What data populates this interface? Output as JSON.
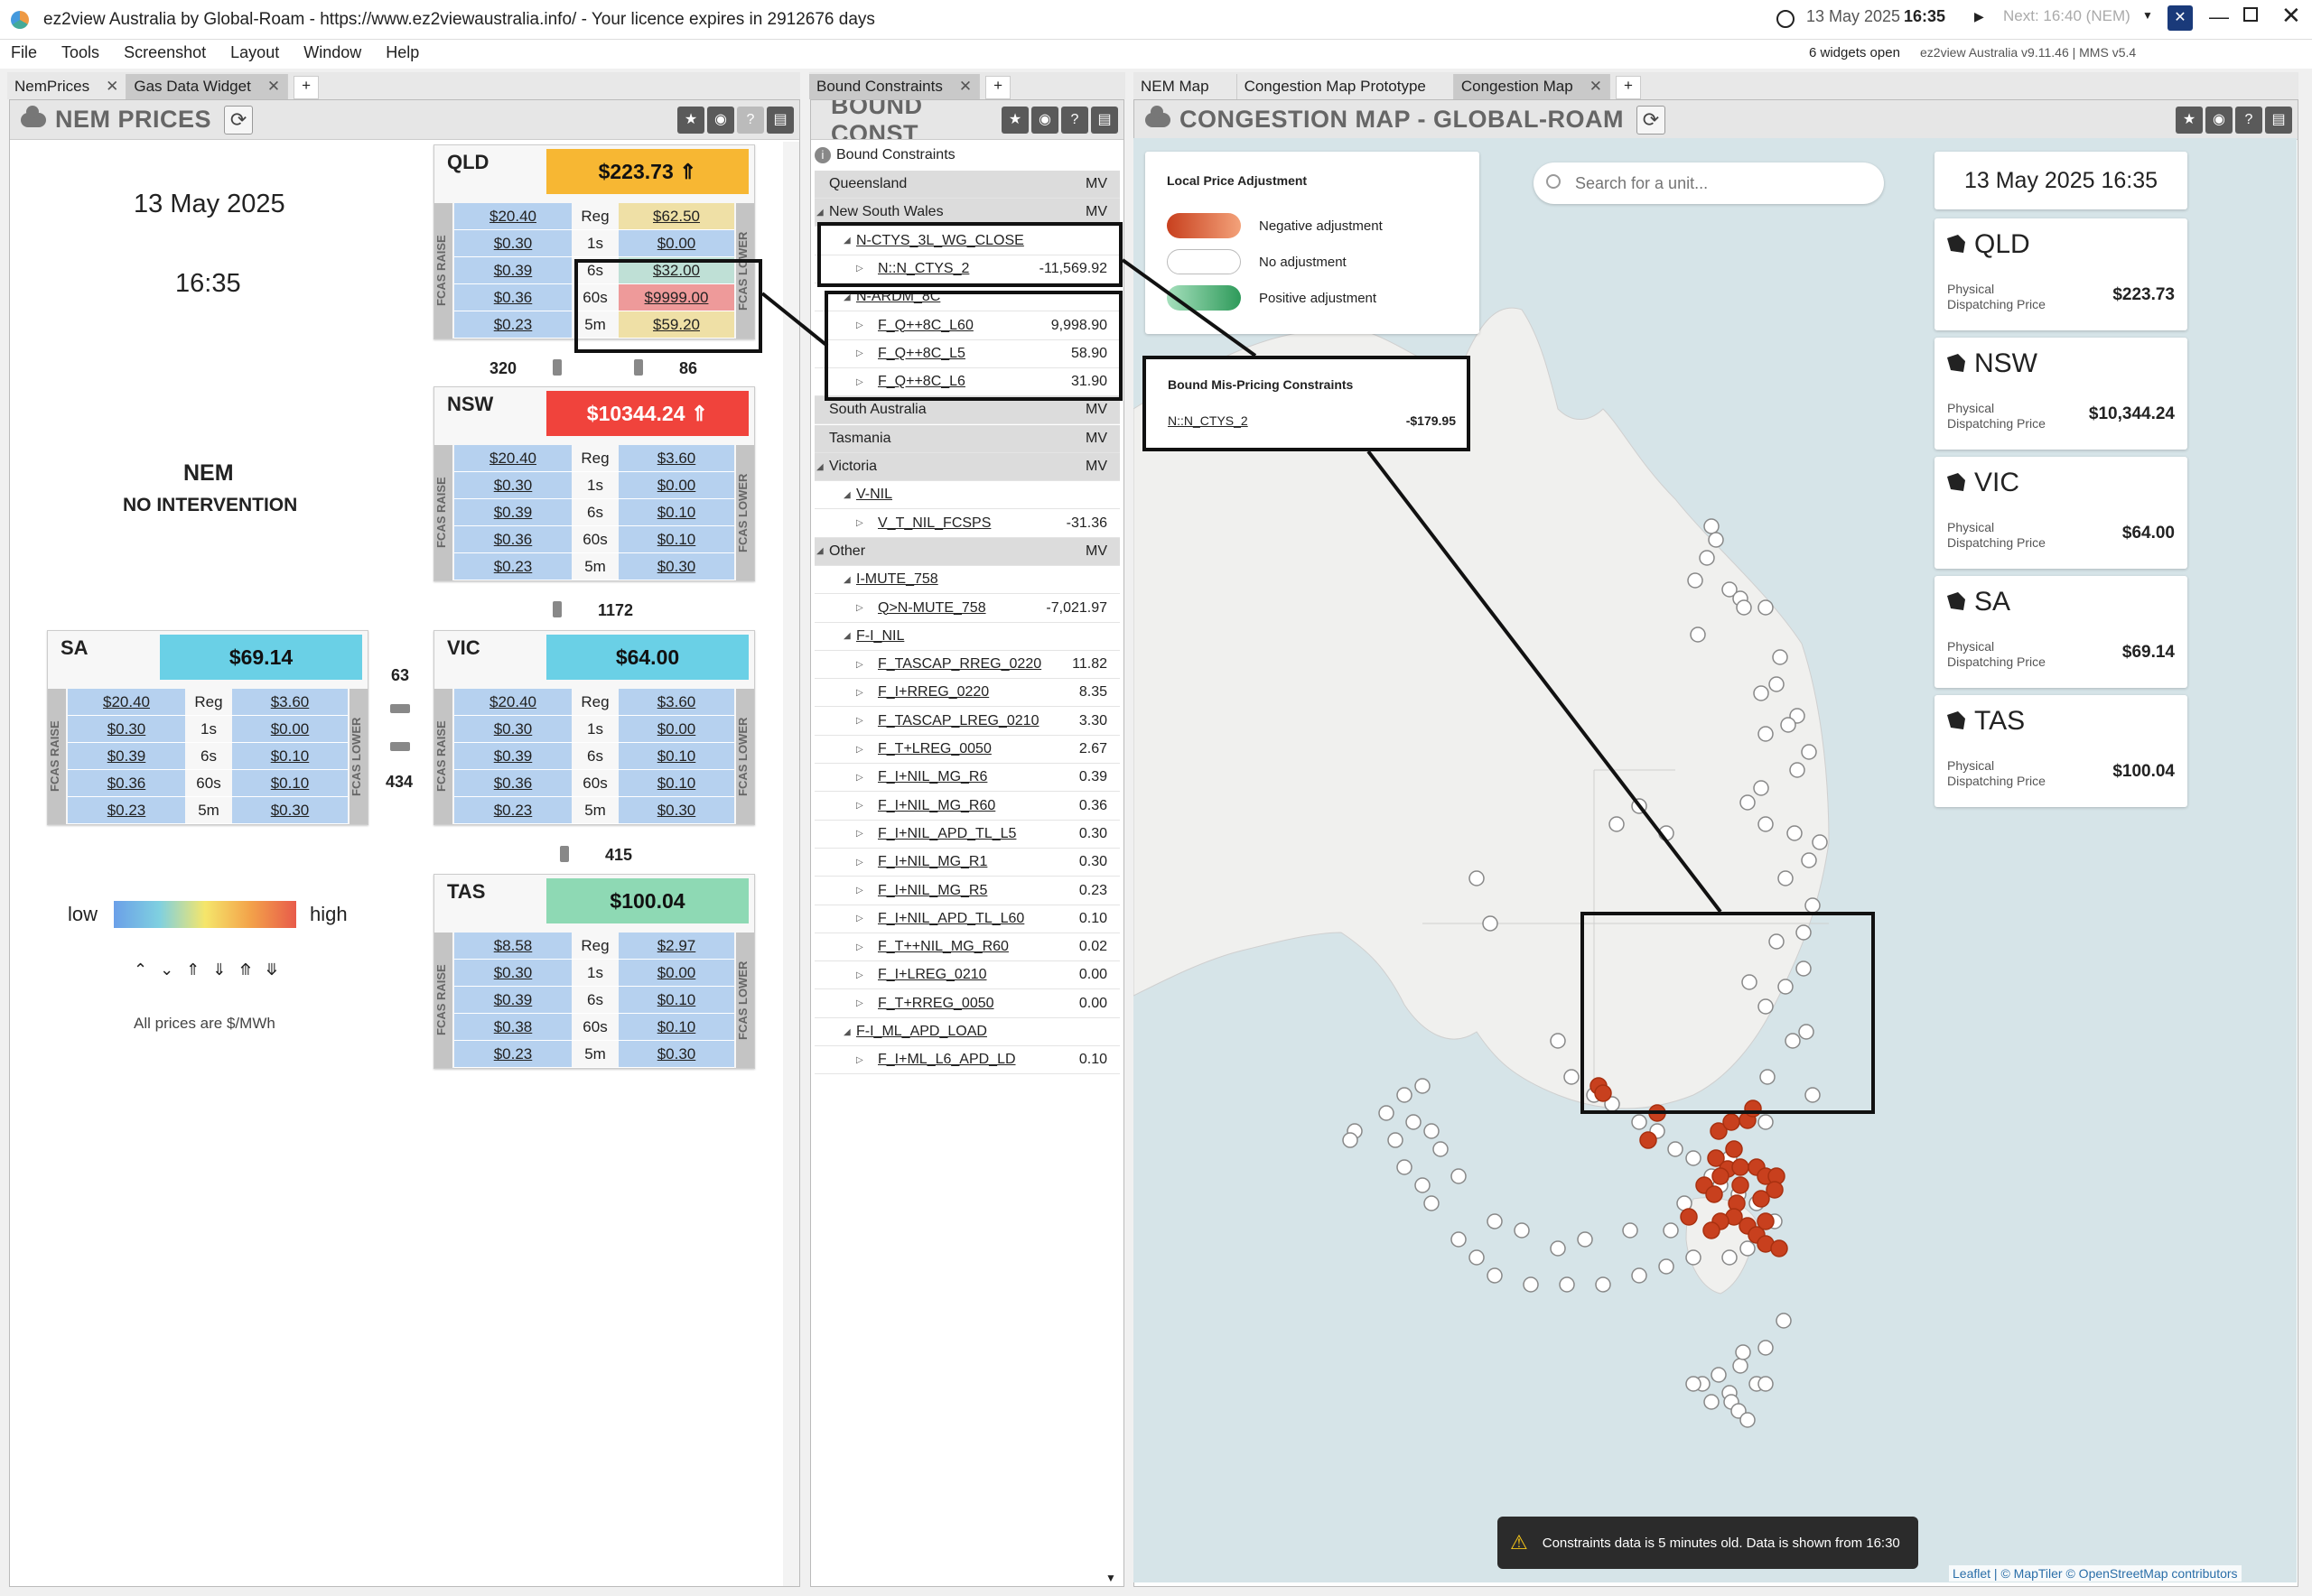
{
  "window": {
    "title": "ez2view Australia by Global-Roam - https://www.ez2viewaustralia.info/ - Your licence expires in 2912676 days",
    "date": "13 May 2025",
    "time": "16:35",
    "next": "Next: 16:40 (NEM)",
    "widgets_open": "6 widgets open",
    "version": "ez2view Australia v9.11.46 | MMS v5.4"
  },
  "menu": [
    "File",
    "Tools",
    "Screenshot",
    "Layout",
    "Window",
    "Help"
  ],
  "tabs_left": [
    "NemPrices",
    "Gas Data Widget"
  ],
  "tabs_mid": [
    "Bound Constraints"
  ],
  "tabs_right": [
    "NEM Map",
    "Congestion Map Prototype",
    "Congestion Map"
  ],
  "nem_prices": {
    "title": "NEM PRICES",
    "date": "13 May 2025",
    "time": "16:35",
    "nem": "NEM",
    "intervention": "NO INTERVENTION",
    "legend_low": "low",
    "legend_high": "high",
    "units_note": "All prices are $/MWh",
    "fcas_raise": "FCAS RAISE",
    "fcas_lower": "FCAS LOWER",
    "labels": [
      "Reg",
      "1s",
      "6s",
      "60s",
      "5m"
    ],
    "regions": {
      "QLD": {
        "name": "QLD",
        "price": "$223.73",
        "raise": [
          "$20.40",
          "$0.30",
          "$0.39",
          "$0.36",
          "$0.23"
        ],
        "lower": [
          "$62.50",
          "$0.00",
          "$32.00",
          "$9999.00",
          "$59.20"
        ]
      },
      "NSW": {
        "name": "NSW",
        "price": "$10344.24",
        "raise": [
          "$20.40",
          "$0.30",
          "$0.39",
          "$0.36",
          "$0.23"
        ],
        "lower": [
          "$3.60",
          "$0.00",
          "$0.10",
          "$0.10",
          "$0.30"
        ]
      },
      "SA": {
        "name": "SA",
        "price": "$69.14",
        "raise": [
          "$20.40",
          "$0.30",
          "$0.39",
          "$0.36",
          "$0.23"
        ],
        "lower": [
          "$3.60",
          "$0.00",
          "$0.10",
          "$0.10",
          "$0.30"
        ]
      },
      "VIC": {
        "name": "VIC",
        "price": "$64.00",
        "raise": [
          "$20.40",
          "$0.30",
          "$0.39",
          "$0.36",
          "$0.23"
        ],
        "lower": [
          "$3.60",
          "$0.00",
          "$0.10",
          "$0.10",
          "$0.30"
        ]
      },
      "TAS": {
        "name": "TAS",
        "price": "$100.04",
        "raise": [
          "$8.58",
          "$0.30",
          "$0.39",
          "$0.38",
          "$0.23"
        ],
        "lower": [
          "$2.97",
          "$0.00",
          "$0.10",
          "$0.10",
          "$0.30"
        ]
      }
    },
    "flows": {
      "qld_nsw_a": "320",
      "qld_nsw_b": "86",
      "nsw_vic": "1172",
      "sa_vic_a": "63",
      "sa_vic_b": "434",
      "vic_tas": "415"
    }
  },
  "bound": {
    "title": "BOUND CONST",
    "root": "Bound Constraints",
    "rows": [
      {
        "t": "Queensland",
        "v": "MV",
        "k": "grp"
      },
      {
        "t": "New South Wales",
        "v": "MV",
        "k": "grp"
      },
      {
        "t": "N-CTYS_3L_WG_CLOSE",
        "v": "",
        "k": "c1"
      },
      {
        "t": "N::N_CTYS_2",
        "v": "-11,569.92",
        "k": "c2"
      },
      {
        "t": "N-ARDM_8C",
        "v": "",
        "k": "c1"
      },
      {
        "t": "F_Q++8C_L60",
        "v": "9,998.90",
        "k": "c2"
      },
      {
        "t": "F_Q++8C_L5",
        "v": "58.90",
        "k": "c2"
      },
      {
        "t": "F_Q++8C_L6",
        "v": "31.90",
        "k": "c2"
      },
      {
        "t": "South Australia",
        "v": "MV",
        "k": "grp"
      },
      {
        "t": "Tasmania",
        "v": "MV",
        "k": "grp"
      },
      {
        "t": "Victoria",
        "v": "MV",
        "k": "grp"
      },
      {
        "t": "V-NIL",
        "v": "",
        "k": "c1"
      },
      {
        "t": "V_T_NIL_FCSPS",
        "v": "-31.36",
        "k": "c2"
      },
      {
        "t": "Other",
        "v": "MV",
        "k": "grp"
      },
      {
        "t": "I-MUTE_758",
        "v": "",
        "k": "c1"
      },
      {
        "t": "Q>N-MUTE_758",
        "v": "-7,021.97",
        "k": "c2"
      },
      {
        "t": "F-I_NIL",
        "v": "",
        "k": "c1"
      },
      {
        "t": "F_TASCAP_RREG_0220",
        "v": "11.82",
        "k": "c2"
      },
      {
        "t": "F_I+RREG_0220",
        "v": "8.35",
        "k": "c2"
      },
      {
        "t": "F_TASCAP_LREG_0210",
        "v": "3.30",
        "k": "c2"
      },
      {
        "t": "F_T+LREG_0050",
        "v": "2.67",
        "k": "c2"
      },
      {
        "t": "F_I+NIL_MG_R6",
        "v": "0.39",
        "k": "c2"
      },
      {
        "t": "F_I+NIL_MG_R60",
        "v": "0.36",
        "k": "c2"
      },
      {
        "t": "F_I+NIL_APD_TL_L5",
        "v": "0.30",
        "k": "c2"
      },
      {
        "t": "F_I+NIL_MG_R1",
        "v": "0.30",
        "k": "c2"
      },
      {
        "t": "F_I+NIL_MG_R5",
        "v": "0.23",
        "k": "c2"
      },
      {
        "t": "F_I+NIL_APD_TL_L60",
        "v": "0.10",
        "k": "c2"
      },
      {
        "t": "F_T++NIL_MG_R60",
        "v": "0.02",
        "k": "c2"
      },
      {
        "t": "F_I+LREG_0210",
        "v": "0.00",
        "k": "c2"
      },
      {
        "t": "F_T+RREG_0050",
        "v": "0.00",
        "k": "c2"
      },
      {
        "t": "F-I_ML_APD_LOAD",
        "v": "",
        "k": "c1"
      },
      {
        "t": "F_I+ML_L6_APD_LD",
        "v": "0.10",
        "k": "c2"
      }
    ]
  },
  "congestion": {
    "title": "CONGESTION MAP - GLOBAL-ROAM",
    "search_placeholder": "Search for a unit...",
    "legend_title": "Local Price Adjustment",
    "legend_neg": "Negative adjustment",
    "legend_none": "No adjustment",
    "legend_pos": "Positive adjustment",
    "mispricing_title": "Bound Mis-Pricing Constraints",
    "mispricing_name": "N::N_CTYS_2",
    "mispricing_value": "-$179.95",
    "datetime": "13 May 2025 16:35",
    "toast": "Constraints data is 5 minutes old. Data is shown from 16:30",
    "attribution": "Leaflet | © MapTiler © OpenStreetMap contributors",
    "price_label": "Physical Dispatching Price",
    "cards": [
      {
        "state": "QLD",
        "price": "$223.73"
      },
      {
        "state": "NSW",
        "price": "$10,344.24"
      },
      {
        "state": "VIC",
        "price": "$64.00"
      },
      {
        "state": "SA",
        "price": "$69.14"
      },
      {
        "state": "TAS",
        "price": "$100.04"
      }
    ],
    "colors": {
      "negative": "#c8401e",
      "none": "#ffffff",
      "positive": "#2e9a5a"
    }
  }
}
